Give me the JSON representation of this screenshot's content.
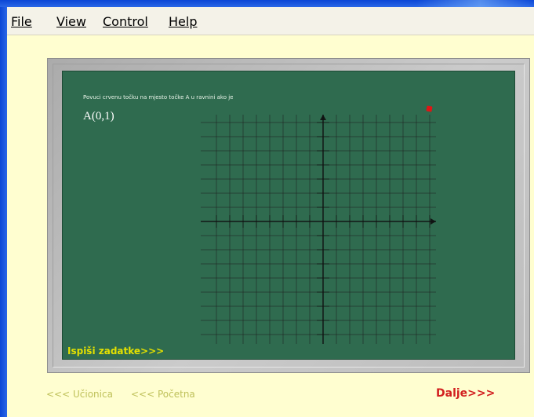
{
  "menubar": {
    "items": [
      {
        "label": "File"
      },
      {
        "label": "View"
      },
      {
        "label": "Control"
      },
      {
        "label": "Help"
      }
    ]
  },
  "board": {
    "instruction": "Povuci crvenu točku na mjesto točke A u ravnini ako je",
    "point_label": "A(0,1)",
    "print_tasks": "Ispiši zadatke>>>",
    "red_dot_color": "#e01515"
  },
  "nav": {
    "classroom": "<<< Učionica",
    "home": "<<< Početna",
    "next": "Dalje>>>"
  },
  "colors": {
    "chalkboard": "#2f6b4f",
    "app_background": "#fffed0",
    "next_link": "#d21f1f",
    "print_tasks": "#e4e000"
  },
  "icons": {
    "red_dot": "red-point-marker-icon"
  }
}
